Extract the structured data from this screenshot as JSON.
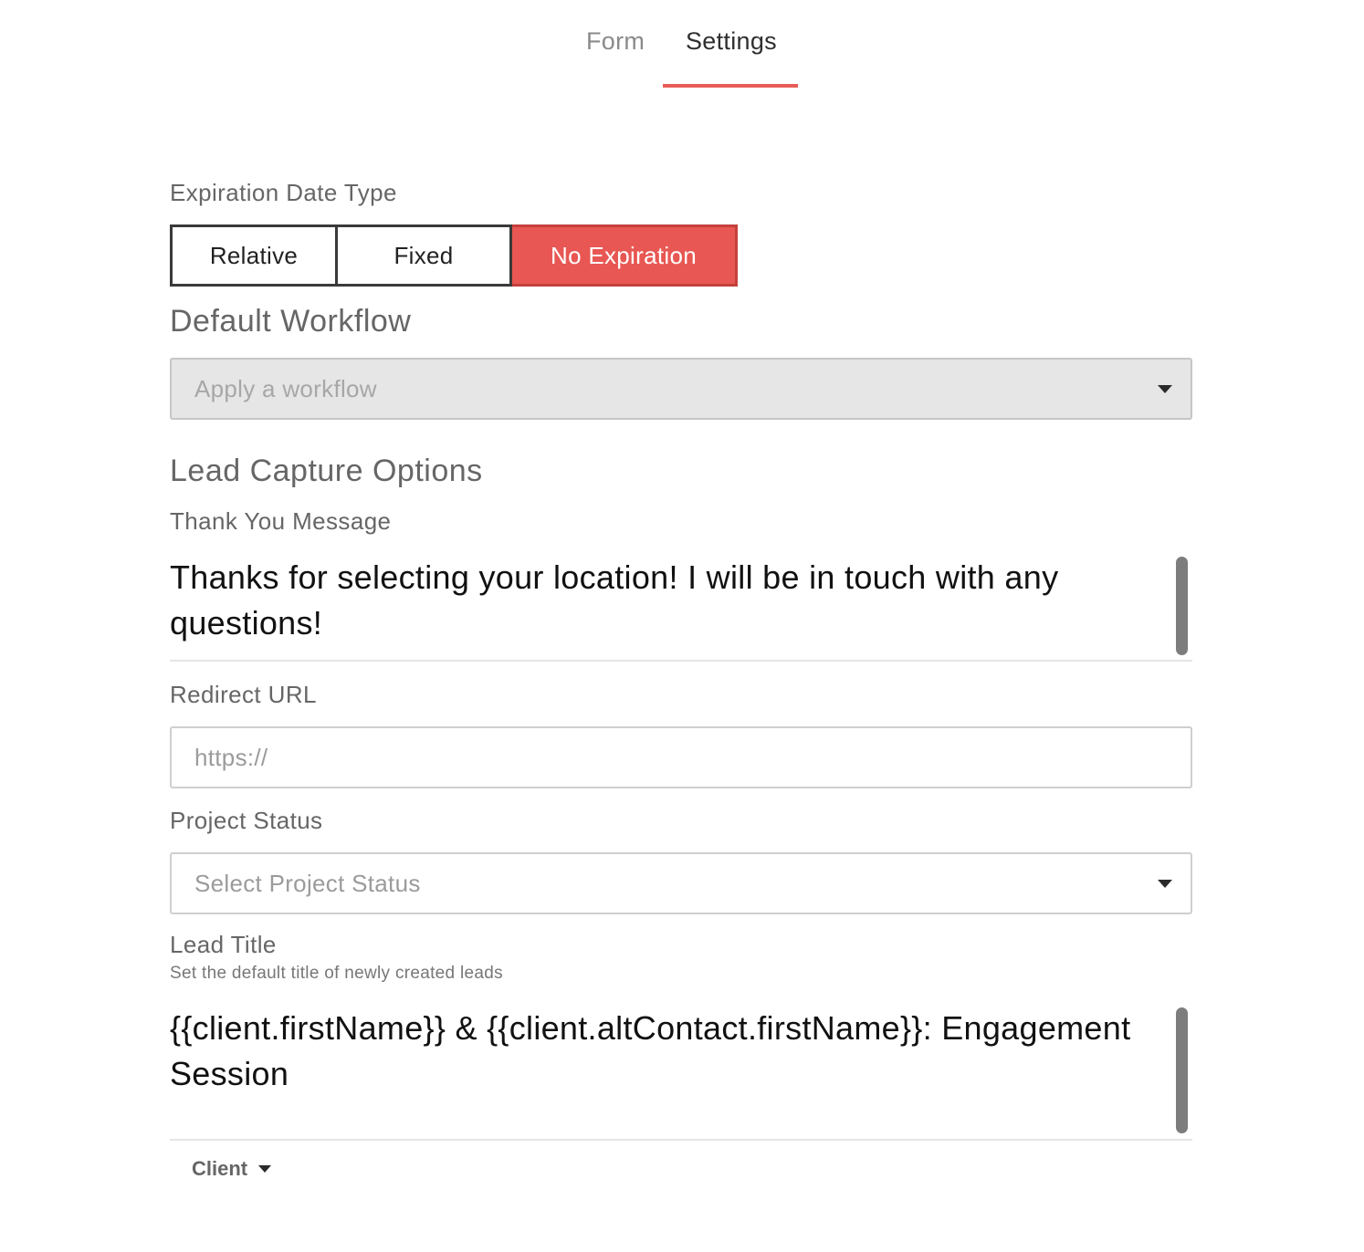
{
  "tabs": {
    "form": "Form",
    "settings": "Settings",
    "active": "Settings"
  },
  "expiration": {
    "label": "Expiration Date Type",
    "options": [
      "Relative",
      "Fixed",
      "No Expiration"
    ],
    "selected": "No Expiration"
  },
  "workflow": {
    "heading": "Default Workflow",
    "placeholder": "Apply a workflow"
  },
  "lead_capture": {
    "heading": "Lead Capture Options",
    "thank_you_label": "Thank You Message",
    "thank_you_text": "Thanks for selecting your location! I will be in touch with any questions!",
    "redirect_label": "Redirect URL",
    "redirect_placeholder": "https://",
    "status_label": "Project Status",
    "status_placeholder": "Select Project Status",
    "lead_title_label": "Lead Title",
    "lead_title_helper": "Set the default title of newly created leads",
    "lead_title_text": "{{client.firstName}} & {{client.altContact.firstName}}: Engagement Session",
    "client_menu": "Client"
  },
  "colors": {
    "accent": "#e85753",
    "tab_underline": "#e85c58"
  }
}
